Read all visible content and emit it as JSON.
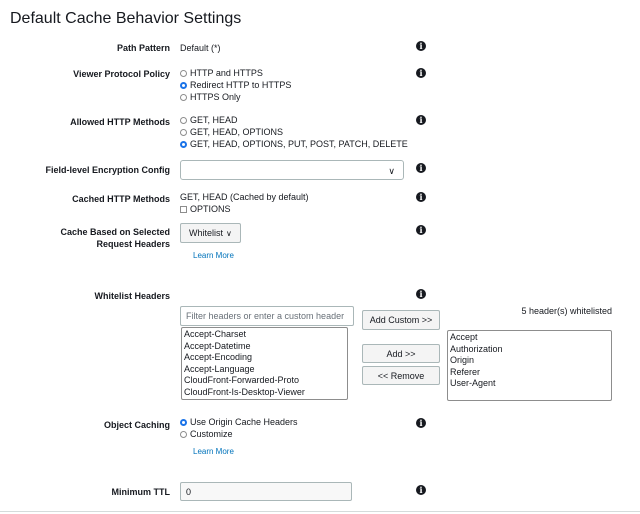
{
  "title": "Default Cache Behavior Settings",
  "fields": {
    "path_pattern": {
      "label": "Path Pattern",
      "value": "Default (*)"
    },
    "viewer_protocol": {
      "label": "Viewer Protocol Policy",
      "options": [
        "HTTP and HTTPS",
        "Redirect HTTP to HTTPS",
        "HTTPS Only"
      ],
      "selected": "Redirect HTTP to HTTPS"
    },
    "allowed_methods": {
      "label": "Allowed HTTP Methods",
      "options": [
        "GET, HEAD",
        "GET, HEAD, OPTIONS",
        "GET, HEAD, OPTIONS, PUT, POST, PATCH, DELETE"
      ],
      "selected": "GET, HEAD, OPTIONS, PUT, POST, PATCH, DELETE"
    },
    "field_encryption": {
      "label": "Field-level Encryption Config",
      "value": ""
    },
    "cached_methods": {
      "label": "Cached HTTP Methods",
      "value": "GET, HEAD (Cached by default)",
      "checkbox_label": "OPTIONS",
      "checked": false
    },
    "cache_headers": {
      "label_line1": "Cache Based on Selected",
      "label_line2": "Request Headers",
      "value": "Whitelist",
      "learn_more": "Learn More"
    },
    "whitelist_headers": {
      "label": "Whitelist Headers",
      "filter_placeholder": "Filter headers or enter a custom header",
      "add_custom": "Add Custom >>",
      "add": "Add >>",
      "remove": "<< Remove",
      "count_text": "5 header(s) whitelisted",
      "available": [
        "Accept-Charset",
        "Accept-Datetime",
        "Accept-Encoding",
        "Accept-Language",
        "CloudFront-Forwarded-Proto",
        "CloudFront-Is-Desktop-Viewer"
      ],
      "whitelisted": [
        "Accept",
        "Authorization",
        "Origin",
        "Referer",
        "User-Agent"
      ]
    },
    "object_caching": {
      "label": "Object Caching",
      "options": [
        "Use Origin Cache Headers",
        "Customize"
      ],
      "selected": "Use Origin Cache Headers",
      "learn_more": "Learn More"
    },
    "min_ttl": {
      "label": "Minimum TTL",
      "value": "0"
    }
  },
  "icons": {
    "info": "info-icon",
    "chevron": "chevron-down-icon"
  },
  "colors": {
    "radio_selected": "#1a73e8",
    "link": "#0073bb"
  }
}
